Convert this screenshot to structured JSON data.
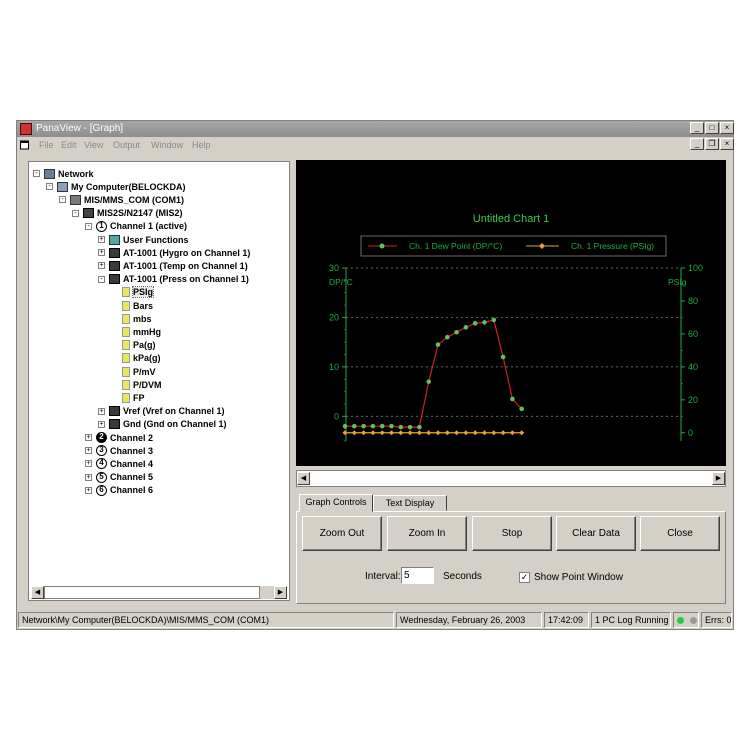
{
  "window": {
    "title": "PanaView - [Graph]",
    "menu": [
      "File",
      "Edit",
      "View",
      "Output",
      "Window",
      "Help"
    ]
  },
  "tree": {
    "items": [
      {
        "label": "Network",
        "level": 0,
        "icon": "network-icon",
        "exp": "-"
      },
      {
        "label": "My Computer(BELOCKDA)",
        "level": 1,
        "icon": "computer-icon",
        "exp": "-"
      },
      {
        "label": "MIS/MMS_COM (COM1)",
        "level": 2,
        "icon": "cable-icon",
        "exp": "-"
      },
      {
        "label": "MIS2S/N2147 (MIS2)",
        "level": 3,
        "icon": "device-icon",
        "exp": "-"
      },
      {
        "label": "Channel 1 (active)",
        "level": 4,
        "icon": "channel-number-icon",
        "num": "1",
        "exp": "-"
      },
      {
        "label": "User Functions",
        "level": 5,
        "icon": "user-functions-icon",
        "exp": "+"
      },
      {
        "label": "AT-1001 (Hygro on Channel 1)",
        "level": 5,
        "icon": "probe-icon",
        "exp": "+"
      },
      {
        "label": "AT-1001 (Temp on Channel 1)",
        "level": 5,
        "icon": "probe-icon",
        "exp": "+"
      },
      {
        "label": "AT-1001 (Press on Channel 1)",
        "level": 5,
        "icon": "probe-icon",
        "exp": "-"
      },
      {
        "label": "PSIg",
        "level": 6,
        "icon": "unit-icon",
        "selected": true
      },
      {
        "label": "Bars",
        "level": 6,
        "icon": "unit-icon"
      },
      {
        "label": "mbs",
        "level": 6,
        "icon": "unit-icon"
      },
      {
        "label": "mmHg",
        "level": 6,
        "icon": "unit-icon"
      },
      {
        "label": "Pa(g)",
        "level": 6,
        "icon": "unit-icon"
      },
      {
        "label": "kPa(g)",
        "level": 6,
        "icon": "unit-icon"
      },
      {
        "label": "P/mV",
        "level": 6,
        "icon": "unit-icon"
      },
      {
        "label": "P/DVM",
        "level": 6,
        "icon": "unit-icon"
      },
      {
        "label": "FP",
        "level": 6,
        "icon": "unit-icon"
      },
      {
        "label": "Vref (Vref on Channel 1)",
        "level": 5,
        "icon": "probe-icon",
        "exp": "+"
      },
      {
        "label": "Gnd (Gnd on Channel 1)",
        "level": 5,
        "icon": "probe-icon",
        "exp": "+"
      },
      {
        "label": "Channel 2",
        "level": 4,
        "icon": "channel-number-icon",
        "num": "2",
        "fill": true,
        "exp": "+"
      },
      {
        "label": "Channel 3",
        "level": 4,
        "icon": "channel-number-icon",
        "num": "3",
        "exp": "+"
      },
      {
        "label": "Channel 4",
        "level": 4,
        "icon": "channel-number-icon",
        "num": "4",
        "exp": "+"
      },
      {
        "label": "Channel 5",
        "level": 4,
        "icon": "channel-number-icon",
        "num": "5",
        "exp": "+"
      },
      {
        "label": "Channel 6",
        "level": 4,
        "icon": "channel-number-icon",
        "num": "6",
        "exp": "+"
      }
    ]
  },
  "chart_data": {
    "type": "line",
    "title": "Untitled Chart 1",
    "ylabel": "DP/°C",
    "y2label": "PSIg",
    "ylim": [
      -5,
      30
    ],
    "y2lim": [
      -5,
      100
    ],
    "yticks": [
      0,
      10,
      20,
      30
    ],
    "y2ticks": [
      0,
      20,
      40,
      60,
      80,
      100
    ],
    "grid": true,
    "legend": "top",
    "series": [
      {
        "name": "Ch. 1 Dew Point (DP/°C)",
        "axis": "left",
        "color": "#cc2222",
        "marker_color": "#66bb66",
        "x": [
          0,
          1,
          2,
          3,
          4,
          5,
          6,
          7,
          8,
          9,
          10,
          11,
          12,
          13,
          14,
          15,
          16,
          17,
          18,
          19
        ],
        "y": [
          -2,
          -2,
          -2,
          -2,
          -2,
          -2,
          -2.2,
          -2.2,
          -2.2,
          7,
          14.5,
          16,
          17,
          18,
          18.8,
          19,
          19.5,
          12,
          3.5,
          1.5
        ]
      },
      {
        "name": "Ch. 1 Pressure (PSIg)",
        "axis": "right",
        "color": "#d4b020",
        "marker_color": "#f0a030",
        "x": [
          0,
          1,
          2,
          3,
          4,
          5,
          6,
          7,
          8,
          9,
          10,
          11,
          12,
          13,
          14,
          15,
          16,
          17,
          18,
          19
        ],
        "y": [
          0,
          0,
          0,
          0,
          0,
          0,
          0,
          0,
          0,
          0,
          0,
          0,
          0,
          0,
          0,
          0,
          0,
          0,
          0,
          0
        ]
      }
    ]
  },
  "tabs": {
    "graph_controls": "Graph Controls",
    "text_display": "Text Display"
  },
  "controls": {
    "zoom_out": "Zoom Out",
    "zoom_in": "Zoom In",
    "stop": "Stop",
    "clear_data": "Clear Data",
    "close": "Close",
    "interval_label": "Interval:",
    "interval_value": "5",
    "seconds_label": "Seconds",
    "show_point_window": "Show Point Window"
  },
  "status": {
    "path": "Network\\My Computer(BELOCKDA)\\MIS/MMS_COM (COM1)",
    "date": "Wednesday, February 26, 2003",
    "time": "17:42:09",
    "log": "1 PC Log Running",
    "errs": "Errs: 0"
  },
  "colors": {
    "grid_green": "#22aa44",
    "title_green": "#33cc55",
    "led_green": "#22cc44",
    "led_gray": "#9a9a9a"
  }
}
